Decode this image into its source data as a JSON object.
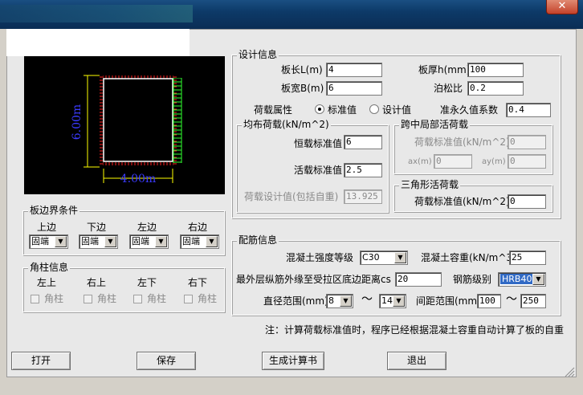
{
  "window": {
    "close_glyph": "✕"
  },
  "preview": {
    "dim_height": "6.00m",
    "dim_width": "4.00m"
  },
  "boundary": {
    "title": "板边界条件",
    "cols": [
      {
        "label": "上边",
        "value": "固端"
      },
      {
        "label": "下边",
        "value": "固端"
      },
      {
        "label": "左边",
        "value": "固端"
      },
      {
        "label": "右边",
        "value": "固端"
      }
    ]
  },
  "corner": {
    "title": "角柱信息",
    "cols": [
      {
        "label": "左上",
        "check": "角柱"
      },
      {
        "label": "右上",
        "check": "角柱"
      },
      {
        "label": "左下",
        "check": "角柱"
      },
      {
        "label": "右下",
        "check": "角柱"
      }
    ]
  },
  "design": {
    "title": "设计信息",
    "length_label": "板长L(m)",
    "length": "4",
    "thickness_label": "板厚h(mm)",
    "thickness": "100",
    "width_label": "板宽B(m)",
    "width": "6",
    "poisson_label": "泊松比",
    "poisson": "0.2",
    "load_attr_label": "荷载属性",
    "radio_std": "标准值",
    "radio_design": "设计值",
    "quasi_label": "准永久值系数",
    "quasi": "0.4"
  },
  "uniform": {
    "title": "均布荷载(kN/m^2)",
    "dead_label": "恒载标准值",
    "dead": "6",
    "live_label": "活载标准值",
    "live": "2.5",
    "design_label": "荷载设计值(包括自重)",
    "design": "13.925"
  },
  "midspan": {
    "title": "跨中局部活荷载",
    "std_label": "荷载标准值(kN/m^2)",
    "std": "0",
    "ax_label": "ax(m)",
    "ax": "0",
    "ay_label": "ay(m)",
    "ay": "0"
  },
  "triangle": {
    "title": "三角形活荷载",
    "std_label": "荷载标准值(kN/m^2)",
    "std": "0"
  },
  "rebar": {
    "title": "配筋信息",
    "concrete_label": "混凝土强度等级",
    "concrete": "C30",
    "density_label": "混凝土容重(kN/m^3)",
    "density": "25",
    "cover_label": "最外层纵筋外缘至受拉区底边距离cs",
    "cover": "20",
    "grade_label": "钢筋级别",
    "grade": "HRB400",
    "dia_label": "直径范围(mm)",
    "dia_min": "8",
    "tilde": "～",
    "dia_max": "14",
    "spacing_label": "间距范围(mm)",
    "spacing_min": "100",
    "spacing_max": "250"
  },
  "note": "注：计算荷载标准值时，程序已经根据混凝土容重自动计算了板的自重",
  "buttons": {
    "open": "打开",
    "save": "保存",
    "generate": "生成计算书",
    "exit": "退出"
  }
}
